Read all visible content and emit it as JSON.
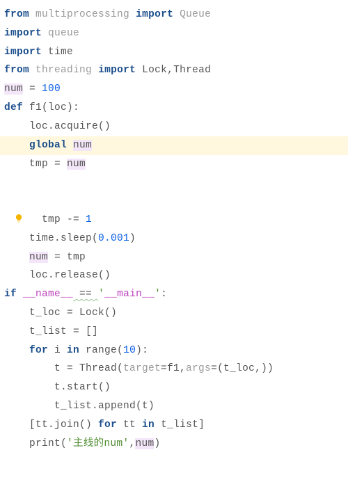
{
  "lines": {
    "l1": {
      "from": "from",
      "mod": "multiprocessing",
      "imp": "import",
      "name": "Queue"
    },
    "l2": {
      "imp": "import",
      "mod": "queue"
    },
    "l3": {
      "imp": "import",
      "mod": "time"
    },
    "l4": {
      "from": "from",
      "mod": "threading",
      "imp": "import",
      "names": "Lock,Thread"
    },
    "l5": {
      "var": "num",
      "eq": " = ",
      "val": "100"
    },
    "l6": {
      "def": "def",
      "fn": "f1",
      "args": "(loc):"
    },
    "l7": {
      "code": "loc.acquire()"
    },
    "l8": {
      "kw": "global",
      "var": "num"
    },
    "l9": {
      "lhs": "tmp = ",
      "rhs": "num"
    },
    "l10": {
      "lhs": "tmp -= ",
      "val": "1"
    },
    "l11": {
      "a": "time.sleep(",
      "val": "0.001",
      "b": ")"
    },
    "l12": {
      "lhs": "num",
      "rhs": " = tmp"
    },
    "l13": {
      "code": "loc.release()"
    },
    "l14": {
      "kw": "if",
      "dname": "__name__",
      "eq": " == ",
      "q1": "'",
      "dmain": "__main__",
      "q2": "'",
      "colon": ":"
    },
    "l15": {
      "code": "t_loc = Lock()"
    },
    "l16": {
      "code": "t_list = []"
    },
    "l17": {
      "for": "for",
      "mid": " i ",
      "in": "in",
      "rng": " range(",
      "val": "10",
      "end": "):"
    },
    "l18": {
      "a": "t = Thread(",
      "p1k": "target",
      "p1e": "=f1,",
      "p2k": "args",
      "p2e": "=(t_loc,))"
    },
    "l19": {
      "code": "t.start()"
    },
    "l20": {
      "code": "t_list.append(t)"
    },
    "l21": {
      "a": "[tt.join() ",
      "for": "for",
      "mid": " tt ",
      "in": "in",
      "b": " t_list]"
    },
    "l22": {
      "a": "print(",
      "str": "'主线的num'",
      "b": ",",
      "var": "num",
      "c": ")"
    }
  }
}
